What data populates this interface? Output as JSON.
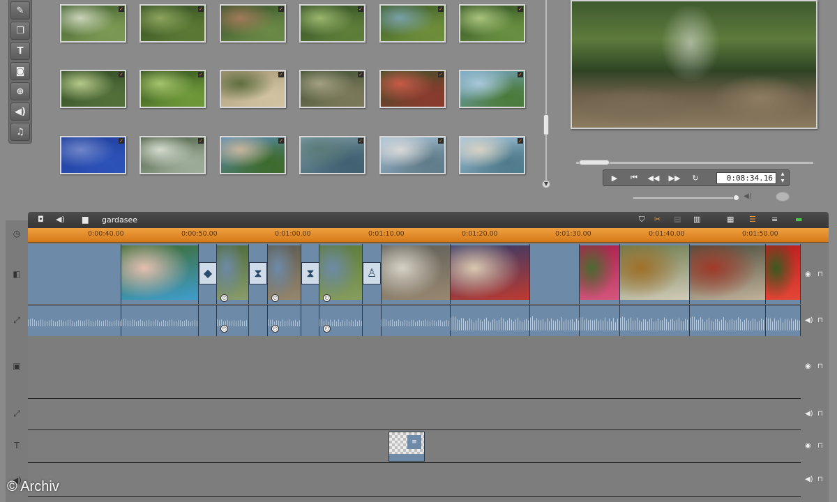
{
  "toolbar_left": {
    "tools": [
      {
        "icon": "pen-image-icon",
        "glyph": "✎"
      },
      {
        "icon": "transition-icon",
        "glyph": "❐"
      },
      {
        "icon": "title-icon",
        "glyph": "T"
      },
      {
        "icon": "camera-icon",
        "glyph": "◙"
      },
      {
        "icon": "disc-menu-icon",
        "glyph": "⊕"
      },
      {
        "icon": "sound-effect-icon",
        "glyph": "◀)"
      },
      {
        "icon": "music-icon",
        "glyph": "♫"
      }
    ]
  },
  "library": {
    "thumbnails": [
      {
        "scene": "garden path",
        "colors": [
          "#3c5a2a",
          "#7d9a55",
          "#c9d3b8"
        ]
      },
      {
        "scene": "green hedge arch",
        "colors": [
          "#2f4a20",
          "#5c7a35",
          "#8da45e"
        ]
      },
      {
        "scene": "garden visitors",
        "colors": [
          "#34502a",
          "#6b8a46",
          "#a07a58"
        ]
      },
      {
        "scene": "tree canopy",
        "colors": [
          "#2d4a22",
          "#5f7f3a",
          "#9ab56d"
        ]
      },
      {
        "scene": "pond plants",
        "colors": [
          "#3a5a26",
          "#6f8f3c",
          "#7aa0a8"
        ]
      },
      {
        "scene": "bushes",
        "colors": [
          "#2c4a1f",
          "#6a9142",
          "#a9c47c"
        ]
      },
      {
        "scene": "forest light",
        "colors": [
          "#2d4721",
          "#53703a",
          "#b6c98a"
        ]
      },
      {
        "scene": "palm leaves",
        "colors": [
          "#2f4c1c",
          "#6f9a3a",
          "#a5c46c"
        ]
      },
      {
        "scene": "sandy rocks",
        "colors": [
          "#a89878",
          "#d1c3a2",
          "#5e6e3e"
        ]
      },
      {
        "scene": "stream",
        "colors": [
          "#3e4e30",
          "#7b7a5a",
          "#a4a083"
        ]
      },
      {
        "scene": "red flowers",
        "colors": [
          "#3c5128",
          "#8a3a2e",
          "#c85a48"
        ]
      },
      {
        "scene": "sky and trees",
        "colors": [
          "#79a7c9",
          "#4a7a38",
          "#a8c8d8"
        ]
      },
      {
        "scene": "blue wall",
        "colors": [
          "#1e3c9a",
          "#2d52b8",
          "#6f86c8"
        ]
      },
      {
        "scene": "fountain",
        "colors": [
          "#465a3e",
          "#9fae9a",
          "#d4dcd0"
        ]
      },
      {
        "scene": "villa garden",
        "colors": [
          "#5c8db8",
          "#3d6a2a",
          "#c7b59c"
        ]
      },
      {
        "scene": "lake shore",
        "colors": [
          "#7d9aa4",
          "#3f6070",
          "#5a7a78"
        ]
      },
      {
        "scene": "boat passenger",
        "colors": [
          "#a9c4d8",
          "#5f7a88",
          "#d8d8d8"
        ]
      },
      {
        "scene": "lakeside town",
        "colors": [
          "#a8c6dc",
          "#4d7a8a",
          "#d7d2c4"
        ]
      }
    ]
  },
  "player": {
    "timecode": "0:08:34.16",
    "buttons": [
      {
        "icon": "play-icon",
        "glyph": "▶"
      },
      {
        "icon": "skip-start-icon",
        "glyph": "⏮"
      },
      {
        "icon": "rewind-icon",
        "glyph": "◀◀"
      },
      {
        "icon": "forward-icon",
        "glyph": "▶▶"
      },
      {
        "icon": "loop-icon",
        "glyph": "↻"
      }
    ],
    "volume_level": 0.95
  },
  "timeline": {
    "project_name": "gardasee",
    "ruler_ticks": [
      "0:00:40.00",
      "0:00:50.00",
      "0:01:00.00",
      "0:01:10.00",
      "0:01:20.00",
      "0:01:30.00",
      "0:01:40.00",
      "0:01:50.00"
    ],
    "video_clips": [
      {
        "scene": "empty",
        "colors": [
          "#6d8aa8",
          "#6d8aa8",
          "#6d8aa8"
        ]
      },
      {
        "scene": "pool",
        "colors": [
          "#3d6a2a",
          "#3fa0d8",
          "#e5bfb0"
        ]
      },
      {
        "scene": "transition",
        "colors": [
          "#6d8aa8",
          "#6d8aa8",
          "#6d8aa8"
        ]
      },
      {
        "scene": "garden path",
        "colors": [
          "#4d6a3a",
          "#8ea070",
          "#6d8aa8"
        ]
      },
      {
        "scene": "transition",
        "colors": [
          "#6d8aa8",
          "#6d8aa8",
          "#6d8aa8"
        ]
      },
      {
        "scene": "street",
        "colors": [
          "#5b5a50",
          "#9a8a70",
          "#6d8aa8"
        ]
      },
      {
        "scene": "transition",
        "colors": [
          "#6d8aa8",
          "#6d8aa8",
          "#6d8aa8"
        ]
      },
      {
        "scene": "green slope",
        "colors": [
          "#5a7a3a",
          "#8aa060",
          "#6d8aa8"
        ]
      },
      {
        "scene": "transition",
        "colors": [
          "#6d8aa8",
          "#6d8aa8",
          "#6d8aa8"
        ]
      },
      {
        "scene": "market street",
        "colors": [
          "#5e5e58",
          "#9c8a72",
          "#d6d2c6"
        ]
      },
      {
        "scene": "market crowd",
        "colors": [
          "#2f3a6a",
          "#c63a2e",
          "#d9c8b0"
        ]
      },
      {
        "scene": "empty",
        "colors": [
          "#6d8aa8",
          "#6d8aa8",
          "#6d8aa8"
        ]
      },
      {
        "scene": "flowers",
        "colors": [
          "#a8204a",
          "#d85a80",
          "#4a6a30"
        ]
      },
      {
        "scene": "vendor",
        "colors": [
          "#6a7a4a",
          "#d8d0c0",
          "#a0702a"
        ]
      },
      {
        "scene": "fruit stall",
        "colors": [
          "#4a4a3a",
          "#c8b8a0",
          "#a03a2a"
        ]
      },
      {
        "scene": "tomatoes",
        "colors": [
          "#b81e1e",
          "#e84a3a",
          "#3a5a20"
        ]
      }
    ],
    "track_icons": [
      {
        "icon": "video-track-icon",
        "glyph": "◧"
      },
      {
        "icon": "audio-link-icon",
        "glyph": "⤢"
      },
      {
        "icon": "overlay-track-icon",
        "glyph": "▣"
      },
      {
        "icon": "audio-link-icon",
        "glyph": "⤢"
      },
      {
        "icon": "title-track-icon",
        "glyph": "T"
      },
      {
        "icon": "audio-track-icon",
        "glyph": "◀)"
      }
    ]
  },
  "watermark": "© Archiv"
}
